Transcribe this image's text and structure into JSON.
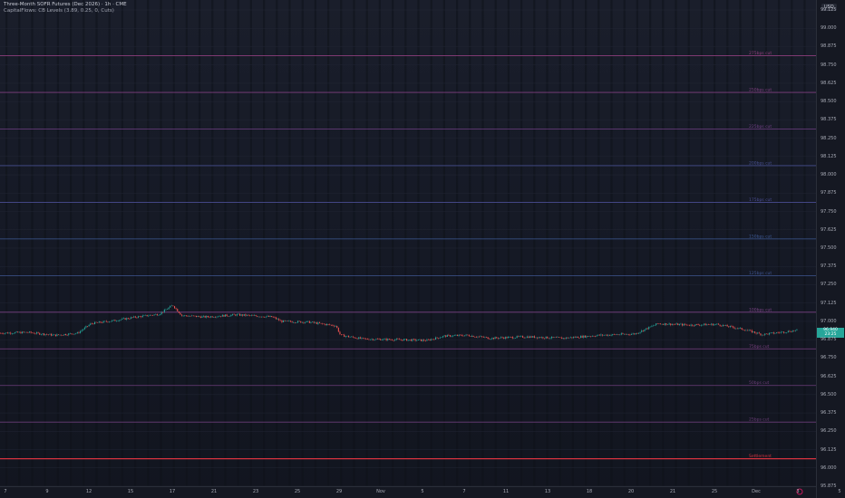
{
  "header": {
    "title": "Three-Month SOFR Futures (Dec 2026) · 1h · CME",
    "indicator": "CapitalFlows: CB Levels (3.89, 0.25, 0, Cuts)"
  },
  "axis": {
    "unit": "USD"
  },
  "current_price": {
    "label": "96.940",
    "sub": "23:25"
  },
  "chart_data": {
    "type": "candlestick",
    "ylim": [
      95.875,
      99.125
    ],
    "y_ticks": [
      99.125,
      99.0,
      98.875,
      98.75,
      98.625,
      98.5,
      98.375,
      98.25,
      98.125,
      98.0,
      97.875,
      97.75,
      97.625,
      97.5,
      97.375,
      97.25,
      97.125,
      97.0,
      96.875,
      96.75,
      96.625,
      96.5,
      96.375,
      96.25,
      96.125,
      96.0,
      95.875
    ],
    "x_ticks": [
      "7",
      "9",
      "12",
      "15",
      "17",
      "21",
      "23",
      "25",
      "29",
      "Nov",
      "5",
      "7",
      "11",
      "13",
      "18",
      "20",
      "21",
      "25",
      "Dec",
      "3",
      "5"
    ],
    "levels": [
      {
        "label": "275bps cut",
        "price": 98.8125,
        "color": "#8e3f7d"
      },
      {
        "label": "250bps cut",
        "price": 98.5625,
        "color": "#7f3f80"
      },
      {
        "label": "225bps cut",
        "price": 98.3125,
        "color": "#703f84"
      },
      {
        "label": "200bps cut",
        "price": 98.0625,
        "color": "#47508f"
      },
      {
        "label": "175bps cut",
        "price": 97.8125,
        "color": "#4a4d92"
      },
      {
        "label": "150bps cut",
        "price": 97.5625,
        "color": "#3c5893"
      },
      {
        "label": "125bps cut",
        "price": 97.3125,
        "color": "#3f5591"
      },
      {
        "label": "100bps cut",
        "price": 97.0625,
        "color": "#7a4385"
      },
      {
        "label": "75bps cut",
        "price": 96.8125,
        "color": "#7a3f80"
      },
      {
        "label": "50bps cut",
        "price": 96.5625,
        "color": "#6d3f7b"
      },
      {
        "label": "25bps cut",
        "price": 96.3125,
        "color": "#6b3d78"
      },
      {
        "label": "Settlement",
        "price": 96.0625,
        "color": "#d5333f"
      }
    ],
    "series": [
      {
        "x": 0,
        "y": 96.92
      },
      {
        "x": 30,
        "y": 96.925
      },
      {
        "x": 60,
        "y": 96.905
      },
      {
        "x": 85,
        "y": 96.92
      },
      {
        "x": 100,
        "y": 96.985
      },
      {
        "x": 125,
        "y": 97.005
      },
      {
        "x": 150,
        "y": 97.03
      },
      {
        "x": 175,
        "y": 97.05
      },
      {
        "x": 190,
        "y": 97.11
      },
      {
        "x": 200,
        "y": 97.04
      },
      {
        "x": 225,
        "y": 97.03
      },
      {
        "x": 260,
        "y": 97.045
      },
      {
        "x": 300,
        "y": 97.03
      },
      {
        "x": 310,
        "y": 97.0
      },
      {
        "x": 340,
        "y": 96.995
      },
      {
        "x": 370,
        "y": 96.97
      },
      {
        "x": 375,
        "y": 96.905
      },
      {
        "x": 400,
        "y": 96.88
      },
      {
        "x": 440,
        "y": 96.875
      },
      {
        "x": 470,
        "y": 96.87
      },
      {
        "x": 490,
        "y": 96.9
      },
      {
        "x": 515,
        "y": 96.905
      },
      {
        "x": 540,
        "y": 96.885
      },
      {
        "x": 580,
        "y": 96.895
      },
      {
        "x": 620,
        "y": 96.885
      },
      {
        "x": 660,
        "y": 96.905
      },
      {
        "x": 700,
        "y": 96.915
      },
      {
        "x": 725,
        "y": 96.985
      },
      {
        "x": 760,
        "y": 96.975
      },
      {
        "x": 790,
        "y": 96.98
      },
      {
        "x": 820,
        "y": 96.945
      },
      {
        "x": 840,
        "y": 96.91
      },
      {
        "x": 860,
        "y": 96.925
      },
      {
        "x": 880,
        "y": 96.94
      }
    ]
  }
}
